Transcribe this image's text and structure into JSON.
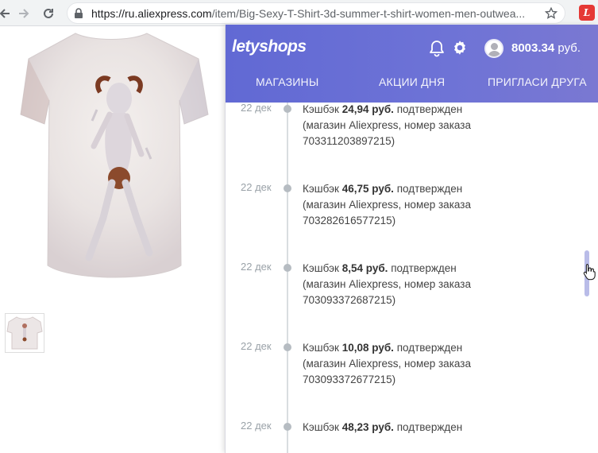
{
  "browser": {
    "url_host": "https://ru.aliexpress.com",
    "url_path": "/item/Big-Sexy-T-Shirt-3d-summer-t-shirt-women-men-outwea...",
    "extension_letter": "L"
  },
  "popup": {
    "logo": "letyshops",
    "balance_value": "8003.34",
    "balance_currency": "руб.",
    "tabs": [
      "МАГАЗИНЫ",
      "АКЦИИ ДНЯ",
      "ПРИГЛАСИ ДРУГА"
    ],
    "accent_color": "#6a6fd5",
    "feed": [
      {
        "date": "22 дек",
        "prefix": "Кэшбэк",
        "amount": "24,94 руб.",
        "status": "подтвержден",
        "line2": "(магазин Aliexpress, номер заказа",
        "line3": "703311203897215)"
      },
      {
        "date": "22 дек",
        "prefix": "Кэшбэк",
        "amount": "46,75 руб.",
        "status": "подтвержден",
        "line2": "(магазин Aliexpress, номер заказа",
        "line3": "703282616577215)"
      },
      {
        "date": "22 дек",
        "prefix": "Кэшбэк",
        "amount": "8,54 руб.",
        "status": "подтвержден",
        "line2": "(магазин Aliexpress, номер заказа",
        "line3": "703093372687215)"
      },
      {
        "date": "22 дек",
        "prefix": "Кэшбэк",
        "amount": "10,08 руб.",
        "status": "подтвержден",
        "line2": "(магазин Aliexpress, номер заказа",
        "line3": "703093372677215)"
      },
      {
        "date": "22 дек",
        "prefix": "Кэшбэк",
        "amount": "48,23 руб.",
        "status": "подтвержден",
        "line2": "",
        "line3": ""
      }
    ]
  }
}
